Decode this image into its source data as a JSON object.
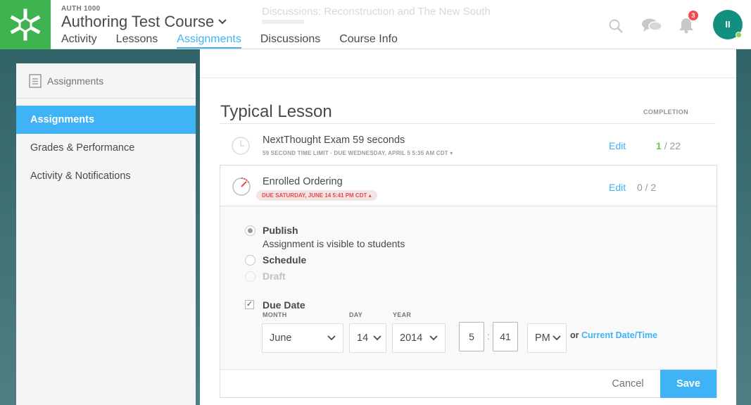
{
  "header": {
    "ghost_title": "Discussions: Reconstruction and The New South",
    "course_code": "AUTH 1000",
    "course_title": "Authoring Test Course",
    "tabs": [
      {
        "label": "Activity"
      },
      {
        "label": "Lessons"
      },
      {
        "label": "Assignments",
        "active": true
      },
      {
        "label": "Discussions"
      },
      {
        "label": "Course Info"
      }
    ],
    "notification_count": "3",
    "avatar_initials": "II",
    "icons": [
      "search-icon",
      "chat-icon",
      "bell-icon"
    ]
  },
  "sidebar": {
    "title": "Assignments",
    "items": [
      {
        "label": "Assignments",
        "active": true
      },
      {
        "label": "Grades & Performance"
      },
      {
        "label": "Activity & Notifications"
      }
    ]
  },
  "main": {
    "lesson_title": "Typical Lesson",
    "completion_label": "COMPLETION",
    "assignments": [
      {
        "title": "NextThought Exam 59 seconds",
        "meta_limit": "59 SECOND TIME LIMIT",
        "meta_due": "DUE WEDNESDAY, APRIL 5 5:35 AM CDT",
        "edit_label": "Edit",
        "completed": "1",
        "total": "/ 22"
      },
      {
        "title": "Enrolled Ordering",
        "due_pill": "DUE SATURDAY, JUNE 14 5:41 PM CDT",
        "edit_label": "Edit",
        "completion": "0 / 2"
      }
    ],
    "editor": {
      "publish_label": "Publish",
      "publish_desc": "Assignment is visible to students",
      "schedule_label": "Schedule",
      "draft_label": "Draft",
      "selected_option": "Publish",
      "due_date_label": "Due Date",
      "due_date_checked": true,
      "month_label": "MONTH",
      "day_label": "DAY",
      "year_label": "YEAR",
      "month_value": "June",
      "day_value": "14",
      "year_value": "2014",
      "hour_value": "5",
      "minute_value": "41",
      "colon": ":",
      "ampm_value": "PM",
      "or_text": "or",
      "current_link": "Current Date/Time",
      "cancel_label": "Cancel",
      "save_label": "Save"
    }
  },
  "colors": {
    "accent": "#3fb3f6",
    "brand_green": "#3fb34f",
    "avatar": "#138f80",
    "due_red": "#e14d4d"
  }
}
